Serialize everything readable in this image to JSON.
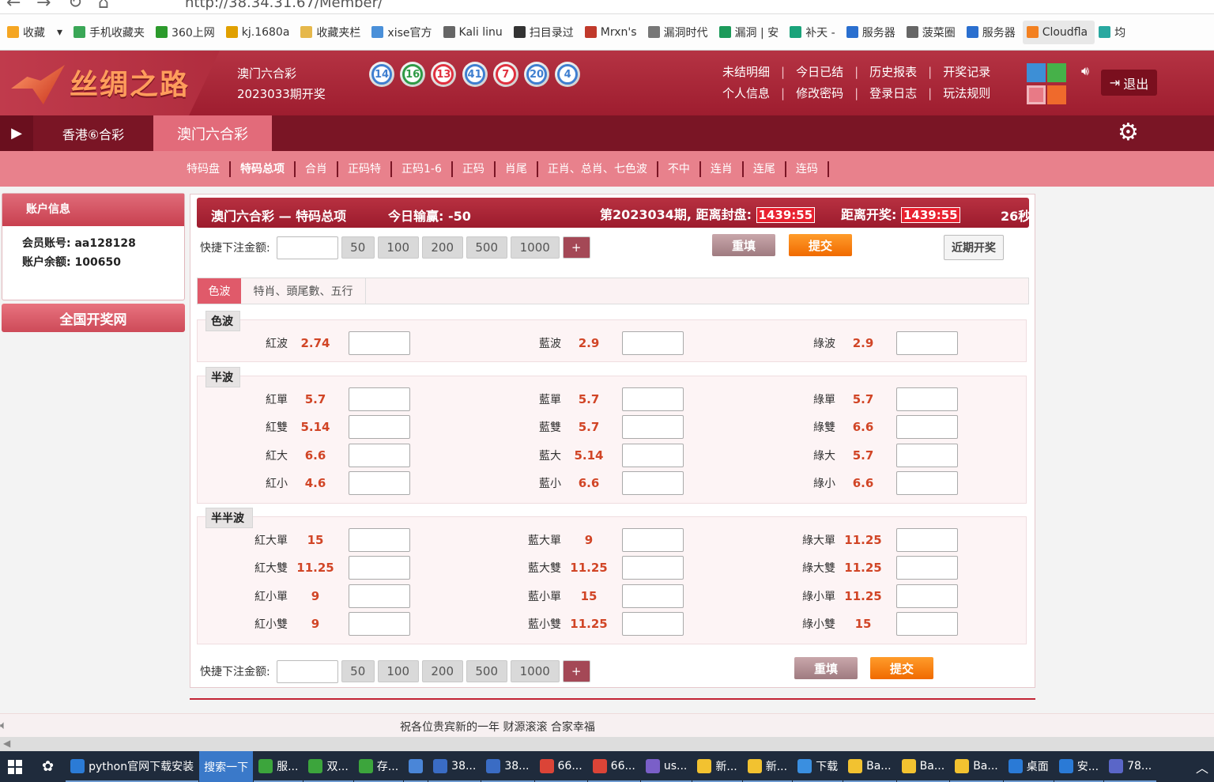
{
  "browser": {
    "url": "http://38.34.31.67/Member/",
    "bookmarks": [
      {
        "label": "收藏",
        "icon": "star-icon",
        "color": "#f5a623"
      },
      {
        "label": "手机收藏夹",
        "icon": "phone-icon",
        "color": "#3aa757"
      },
      {
        "label": "360上网",
        "icon": "360-icon",
        "color": "#2c9a2c"
      },
      {
        "label": "kj.1680a",
        "icon": "kj-icon",
        "color": "#e0a000"
      },
      {
        "label": "收藏夹栏",
        "icon": "folder-icon",
        "color": "#e6b84b"
      },
      {
        "label": "xise官方",
        "icon": "s-icon",
        "color": "#4a90d9"
      },
      {
        "label": "Kali linu",
        "icon": "globe-icon",
        "color": "#666666"
      },
      {
        "label": "扫目录过",
        "icon": "scan-icon",
        "color": "#333333"
      },
      {
        "label": "Mrxn's",
        "icon": "mrxn-icon",
        "color": "#c0392b"
      },
      {
        "label": "漏洞时代",
        "icon": "x-icon",
        "color": "#777777"
      },
      {
        "label": "漏洞 | 安",
        "icon": "shield-icon",
        "color": "#1c9a5a"
      },
      {
        "label": "补天 -",
        "icon": "butian-icon",
        "color": "#1aa37a"
      },
      {
        "label": "服务器",
        "icon": "server-icon",
        "color": "#2a6fcf"
      },
      {
        "label": "菠菜圈",
        "icon": "globe-icon",
        "color": "#666666"
      },
      {
        "label": "服务器",
        "icon": "server-icon",
        "color": "#2a6fcf"
      },
      {
        "label": "Cloudfla",
        "icon": "cloud-icon",
        "color": "#f38020"
      },
      {
        "label": "均",
        "icon": "refresh-icon",
        "color": "#29a8a0"
      }
    ]
  },
  "header": {
    "logo_text": "丝绸之路",
    "lottery_name": "澳门六合彩",
    "draw_info": "2023033期开奖",
    "balls": [
      {
        "n": "14",
        "color": "#3f7fd0"
      },
      {
        "n": "16",
        "color": "#2f9a46"
      },
      {
        "n": "13",
        "color": "#e0313f"
      },
      {
        "n": "41",
        "color": "#3f7fd0"
      },
      {
        "n": "7",
        "color": "#e0313f"
      },
      {
        "n": "20",
        "color": "#3f7fd0"
      },
      {
        "n": "4",
        "color": "#3f7fd0"
      }
    ],
    "nav_row1": [
      "未结明细",
      "今日已结",
      "历史报表",
      "开奖记录"
    ],
    "nav_row2": [
      "个人信息",
      "修改密码",
      "登录日志",
      "玩法规则"
    ],
    "theme_colors": [
      "#3d8fd6",
      "#46b149",
      "#e87a86",
      "#ef6a2c"
    ],
    "logout": "退出"
  },
  "tabs": [
    {
      "label": "香港⑥合彩",
      "active": false
    },
    {
      "label": "澳门六合彩",
      "active": true
    }
  ],
  "subnav": [
    "特码盘",
    "特码总项",
    "合肖",
    "正码特",
    "正码1-6",
    "正码",
    "肖尾",
    "正肖、总肖、七色波",
    "不中",
    "连肖",
    "连尾",
    "连码"
  ],
  "subnav_current": "特码总项",
  "account": {
    "title": "账户信息",
    "member_label": "会员账号:",
    "member": "aa128128",
    "balance_label": "账户余额:",
    "balance": "100650",
    "national_btn": "全国开奖网"
  },
  "main": {
    "title": "澳门六合彩 — 特码总项",
    "today_label": "今日输赢:",
    "today_value": "-50",
    "period": "第2023034期, 距离封盘:",
    "close_timer": "1439:55",
    "draw_label": "距离开奖:",
    "draw_timer": "1439:55",
    "seconds": "26秒",
    "quick_label": "快捷下注金额:",
    "quick_amounts": [
      "50",
      "100",
      "200",
      "500",
      "1000"
    ],
    "plus": "+",
    "reset": "重填",
    "submit": "提交",
    "recent": "近期开奖",
    "subtabs": [
      "色波",
      "特肖、頭尾數、五行"
    ]
  },
  "sections": [
    {
      "title": "色波",
      "rows": [
        [
          {
            "name": "紅波",
            "odds": "2.74"
          },
          {
            "name": "藍波",
            "odds": "2.9"
          },
          {
            "name": "綠波",
            "odds": "2.9"
          }
        ]
      ]
    },
    {
      "title": "半波",
      "rows": [
        [
          {
            "name": "紅單",
            "odds": "5.7"
          },
          {
            "name": "藍單",
            "odds": "5.7"
          },
          {
            "name": "綠單",
            "odds": "5.7"
          }
        ],
        [
          {
            "name": "紅雙",
            "odds": "5.14"
          },
          {
            "name": "藍雙",
            "odds": "5.7"
          },
          {
            "name": "綠雙",
            "odds": "6.6"
          }
        ],
        [
          {
            "name": "紅大",
            "odds": "6.6"
          },
          {
            "name": "藍大",
            "odds": "5.14"
          },
          {
            "name": "綠大",
            "odds": "5.7"
          }
        ],
        [
          {
            "name": "紅小",
            "odds": "4.6"
          },
          {
            "name": "藍小",
            "odds": "6.6"
          },
          {
            "name": "綠小",
            "odds": "6.6"
          }
        ]
      ]
    },
    {
      "title": "半半波",
      "rows": [
        [
          {
            "name": "紅大單",
            "odds": "15"
          },
          {
            "name": "藍大單",
            "odds": "9"
          },
          {
            "name": "綠大單",
            "odds": "11.25"
          }
        ],
        [
          {
            "name": "紅大雙",
            "odds": "11.25"
          },
          {
            "name": "藍大雙",
            "odds": "11.25"
          },
          {
            "name": "綠大雙",
            "odds": "11.25"
          }
        ],
        [
          {
            "name": "紅小單",
            "odds": "9"
          },
          {
            "name": "藍小單",
            "odds": "15"
          },
          {
            "name": "綠小單",
            "odds": "11.25"
          }
        ],
        [
          {
            "name": "紅小雙",
            "odds": "9"
          },
          {
            "name": "藍小雙",
            "odds": "11.25"
          },
          {
            "name": "綠小雙",
            "odds": "15"
          }
        ]
      ]
    }
  ],
  "footer": {
    "marquee": "祝各位贵宾新的一年 财源滚滚 合家幸福"
  },
  "taskbar": [
    {
      "label": "python官网下载安装",
      "icon": "ie-icon",
      "color": "#2b7bd6"
    },
    {
      "label": "搜索一下",
      "icon": "",
      "color": "#3a79c9"
    },
    {
      "label": "服...",
      "icon": "browser-icon",
      "color": "#3ca53c"
    },
    {
      "label": "双...",
      "icon": "browser-icon",
      "color": "#3ca53c"
    },
    {
      "label": "存...",
      "icon": "browser-icon",
      "color": "#3ca53c"
    },
    {
      "label": "",
      "icon": "app-icon",
      "color": "#4a86d8"
    },
    {
      "label": "38...",
      "icon": "remote-icon",
      "color": "#3a6cc4"
    },
    {
      "label": "38...",
      "icon": "remote-icon",
      "color": "#3a6cc4"
    },
    {
      "label": "66...",
      "icon": "chrome-icon",
      "color": "#db4437"
    },
    {
      "label": "66...",
      "icon": "chrome-icon",
      "color": "#db4437"
    },
    {
      "label": "us...",
      "icon": "image-icon",
      "color": "#7a5fc8"
    },
    {
      "label": "新...",
      "icon": "note-icon",
      "color": "#f2c230"
    },
    {
      "label": "新...",
      "icon": "note-icon",
      "color": "#f2c230"
    },
    {
      "label": "下载",
      "icon": "download-icon",
      "color": "#3a8fe0"
    },
    {
      "label": "Ba...",
      "icon": "note-icon",
      "color": "#f2c230"
    },
    {
      "label": "Ba...",
      "icon": "note-icon",
      "color": "#f2c230"
    },
    {
      "label": "Ba...",
      "icon": "note-icon",
      "color": "#f2c230"
    },
    {
      "label": "桌面",
      "icon": "desktop-icon",
      "color": "#2a7ad6"
    },
    {
      "label": "安...",
      "icon": "translate-icon",
      "color": "#2a7ad6"
    },
    {
      "label": "78...",
      "icon": "chat-icon",
      "color": "#5a66c8"
    }
  ]
}
